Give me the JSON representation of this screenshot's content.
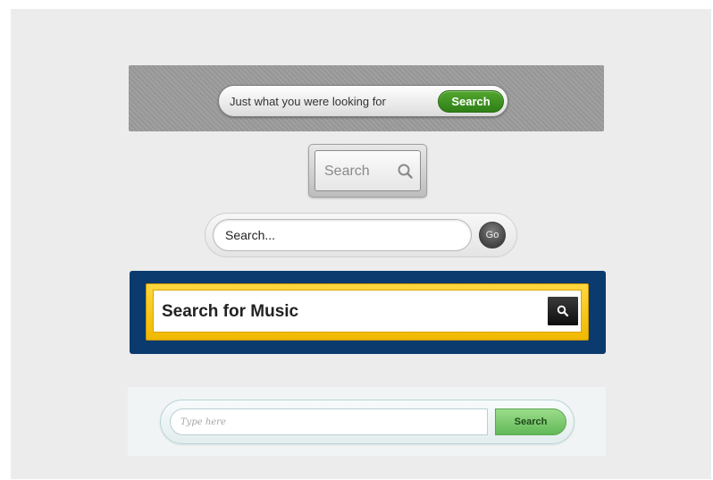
{
  "search_bars": [
    {
      "id": "gray-banner",
      "input_value": "Just what you were looking for",
      "button_label": "Search",
      "colors": {
        "banner": "#9b9b9b",
        "button": "#3c8e1f"
      }
    },
    {
      "id": "boxed",
      "placeholder": "Search",
      "icon": "search-icon",
      "colors": {
        "frame": "#bdbdbd"
      }
    },
    {
      "id": "pill-go",
      "input_value": "Search...",
      "button_label": "Go",
      "colors": {
        "button": "#555555"
      }
    },
    {
      "id": "music",
      "input_value": "Search for Music",
      "icon": "search-icon",
      "colors": {
        "background": "#0b3a6e",
        "frame": "#f4c21a",
        "button": "#111111"
      }
    },
    {
      "id": "light-green",
      "placeholder": "Type here",
      "button_label": "Search",
      "colors": {
        "button": "#7ccb6c",
        "border": "#b8d3d8"
      }
    }
  ]
}
